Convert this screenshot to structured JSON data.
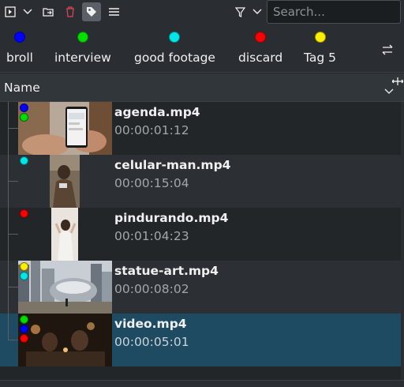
{
  "toolbar": {
    "icons": [
      "add-folder-icon",
      "chevron-down-icon",
      "import-icon",
      "delete-icon",
      "tag-icon",
      "menu-icon",
      "filter-icon",
      "chevron-down-icon"
    ],
    "search_placeholder": "Search..."
  },
  "tags": [
    {
      "label": "broll",
      "color": "#0000ff"
    },
    {
      "label": "interview",
      "color": "#00dd00"
    },
    {
      "label": "good footage",
      "color": "#00e5e5"
    },
    {
      "label": "discard",
      "color": "#ff0000"
    },
    {
      "label": "Tag 5",
      "color": "#ffee00"
    }
  ],
  "header": {
    "title": "Name"
  },
  "files": [
    {
      "name": "agenda.mp4",
      "duration": "00:00:01:12",
      "tags": [
        "#0000ff",
        "#00dd00"
      ]
    },
    {
      "name": "celular-man.mp4",
      "duration": "00:00:15:04",
      "tags": [
        "#00e5e5"
      ]
    },
    {
      "name": "pindurando.mp4",
      "duration": "00:01:04:23",
      "tags": [
        "#ff0000"
      ]
    },
    {
      "name": "statue-art.mp4",
      "duration": "00:00:08:02",
      "tags": [
        "#ffee00",
        "#00e5e5"
      ]
    },
    {
      "name": "video.mp4",
      "duration": "00:00:05:01",
      "tags": [
        "#00dd00",
        "#0000ff",
        "#ff0000"
      ]
    }
  ],
  "colors": {
    "selection": "#1e4b61",
    "background": "#232629"
  }
}
